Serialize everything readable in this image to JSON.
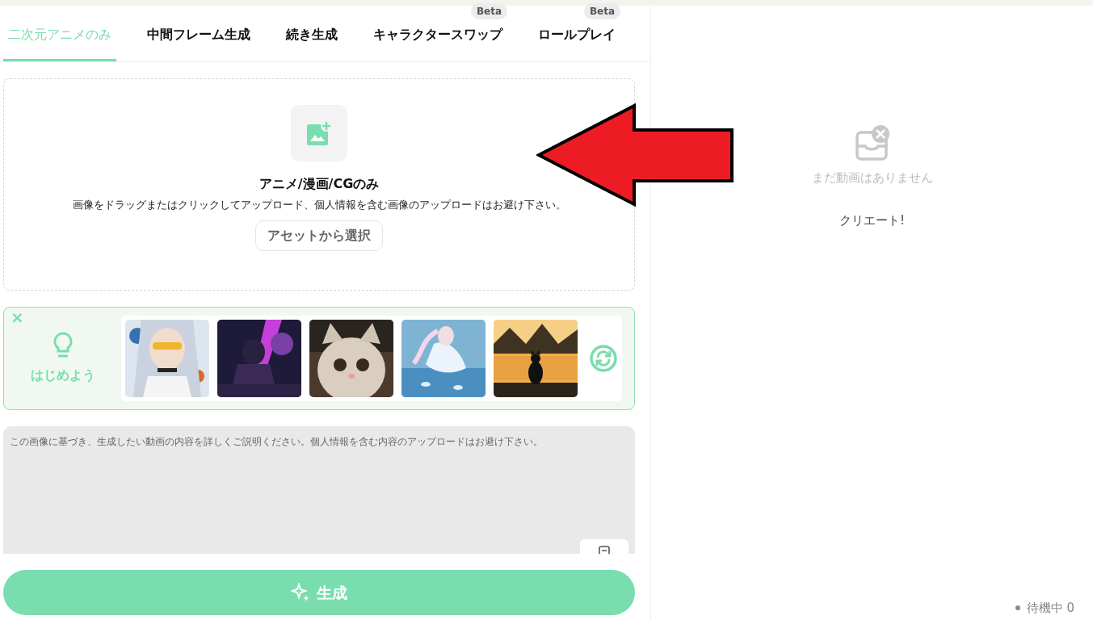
{
  "tabs": [
    {
      "label": "二次元アニメのみ",
      "selected": true
    },
    {
      "label": "中間フレーム生成",
      "selected": false
    },
    {
      "label": "続き生成",
      "selected": false
    },
    {
      "label": "キャラクタースワップ",
      "selected": false,
      "badge": "Beta"
    },
    {
      "label": "ロールプレイ",
      "selected": false,
      "badge": "Beta"
    }
  ],
  "upload": {
    "title": "アニメ/漫画/CGのみ",
    "description": "画像をドラッグまたはクリックしてアップロード、個人情報を含む画像のアップロードはお避け下さい。",
    "button": "アセットから選択"
  },
  "inspiration": {
    "label": "はじめよう",
    "close": "×"
  },
  "prompt": {
    "placeholder": "この画像に基づき、生成したい動画の内容を詳しくご説明ください。個人情報を含む内容のアップロードはお避け下さい。"
  },
  "generate_button": "生成",
  "results": {
    "empty_text": "まだ動画はありません",
    "create_text": "クリエート!",
    "queue": "待機中 0"
  },
  "annotation": {
    "kind": "arrow"
  }
}
